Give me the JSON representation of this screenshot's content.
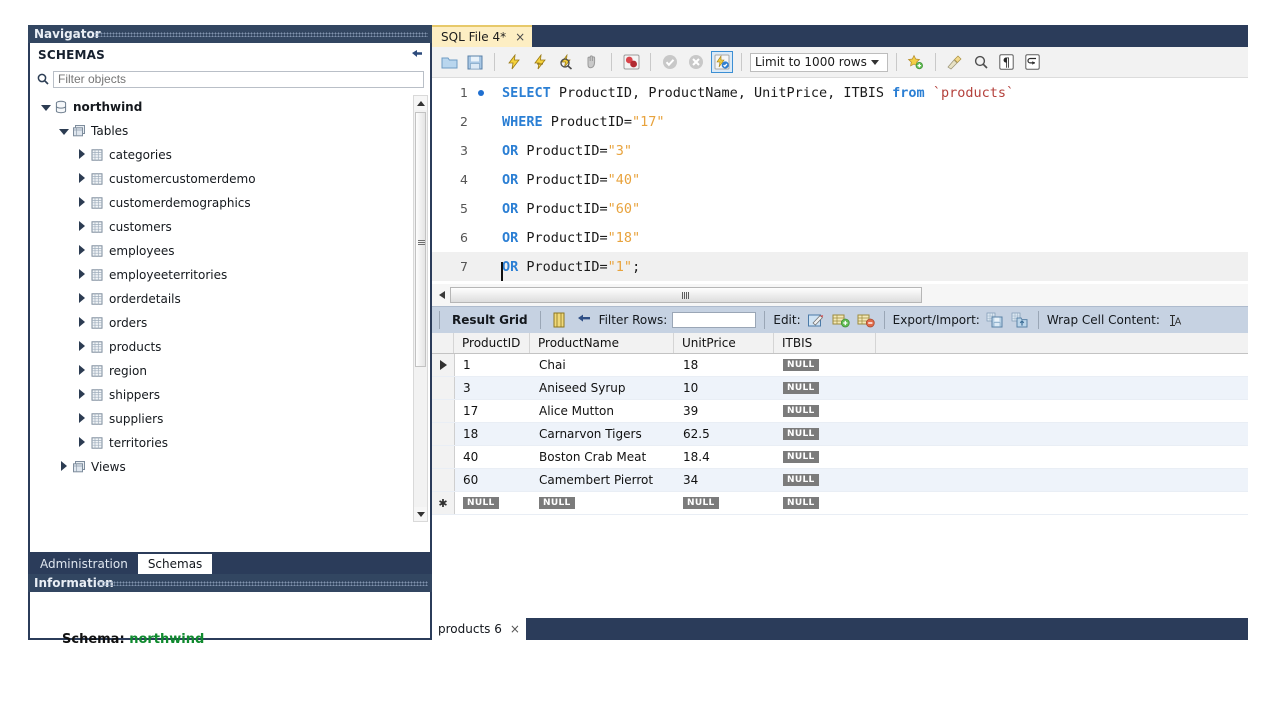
{
  "navigator": {
    "title": "Navigator",
    "schemas_header": "SCHEMAS",
    "refresh_icon": "refresh-icon",
    "filter": {
      "placeholder": "Filter objects",
      "value": "",
      "icon": "search-icon"
    },
    "tree": [
      {
        "label": "northwind",
        "level": 0,
        "expanded": true,
        "icon": "database-icon",
        "bold": true
      },
      {
        "label": "Tables",
        "level": 1,
        "expanded": true,
        "icon": "tables-folder-icon",
        "bold": false
      },
      {
        "label": "categories",
        "level": 2,
        "expanded": false,
        "icon": "table-icon",
        "bold": false
      },
      {
        "label": "customercustomerdemo",
        "level": 2,
        "expanded": false,
        "icon": "table-icon",
        "bold": false
      },
      {
        "label": "customerdemographics",
        "level": 2,
        "expanded": false,
        "icon": "table-icon",
        "bold": false
      },
      {
        "label": "customers",
        "level": 2,
        "expanded": false,
        "icon": "table-icon",
        "bold": false
      },
      {
        "label": "employees",
        "level": 2,
        "expanded": false,
        "icon": "table-icon",
        "bold": false
      },
      {
        "label": "employeeterritories",
        "level": 2,
        "expanded": false,
        "icon": "table-icon",
        "bold": false
      },
      {
        "label": "orderdetails",
        "level": 2,
        "expanded": false,
        "icon": "table-icon",
        "bold": false
      },
      {
        "label": "orders",
        "level": 2,
        "expanded": false,
        "icon": "table-icon",
        "bold": false
      },
      {
        "label": "products",
        "level": 2,
        "expanded": false,
        "icon": "table-icon",
        "bold": false
      },
      {
        "label": "region",
        "level": 2,
        "expanded": false,
        "icon": "table-icon",
        "bold": false
      },
      {
        "label": "shippers",
        "level": 2,
        "expanded": false,
        "icon": "table-icon",
        "bold": false
      },
      {
        "label": "suppliers",
        "level": 2,
        "expanded": false,
        "icon": "table-icon",
        "bold": false
      },
      {
        "label": "territories",
        "level": 2,
        "expanded": false,
        "icon": "table-icon",
        "bold": false
      },
      {
        "label": "Views",
        "level": 1,
        "expanded": false,
        "icon": "views-folder-icon",
        "bold": false
      }
    ],
    "tabs": [
      {
        "label": "Administration",
        "active": false
      },
      {
        "label": "Schemas",
        "active": true
      }
    ]
  },
  "information": {
    "title": "Information",
    "schema_label": "Schema:",
    "schema_value": "northwind",
    "schema_value_color": "#0f8a2e"
  },
  "editor": {
    "tab": {
      "label": "SQL File 4*",
      "close": "×"
    },
    "toolbar": {
      "buttons": [
        {
          "name": "open-sql-script-icon"
        },
        {
          "name": "save-sql-script-icon"
        },
        {
          "name": "execute-statement-icon"
        },
        {
          "name": "execute-current-statement-icon"
        },
        {
          "name": "explain-statement-icon"
        },
        {
          "name": "stop-statement-icon"
        },
        {
          "name": "toggle-stop-on-error-icon"
        },
        {
          "name": "commit-icon"
        },
        {
          "name": "rollback-icon"
        },
        {
          "name": "toggle-autocommit-icon",
          "selected": true
        }
      ],
      "limit_label": "Limit to 1000 rows",
      "right_buttons": [
        {
          "name": "add-snippet-icon"
        },
        {
          "name": "beautify-query-icon"
        },
        {
          "name": "find-icon"
        },
        {
          "name": "toggle-invisible-chars-icon"
        },
        {
          "name": "toggle-word-wrap-icon"
        }
      ]
    },
    "code_lines": [
      {
        "num": "1",
        "breakpoint": true,
        "current": false,
        "tokens": [
          {
            "t": "SELECT",
            "c": "kw"
          },
          {
            "t": " ProductID, ProductName, UnitPrice, ITBIS ",
            "c": ""
          },
          {
            "t": "from",
            "c": "kw"
          },
          {
            "t": " ",
            "c": ""
          },
          {
            "t": "`products`",
            "c": "bq"
          }
        ]
      },
      {
        "num": "2",
        "breakpoint": false,
        "current": false,
        "tokens": [
          {
            "t": "WHERE",
            "c": "kw"
          },
          {
            "t": " ProductID=",
            "c": ""
          },
          {
            "t": "\"17\"",
            "c": "str"
          }
        ]
      },
      {
        "num": "3",
        "breakpoint": false,
        "current": false,
        "tokens": [
          {
            "t": "OR",
            "c": "kw"
          },
          {
            "t": " ProductID=",
            "c": ""
          },
          {
            "t": "\"3\"",
            "c": "str"
          }
        ]
      },
      {
        "num": "4",
        "breakpoint": false,
        "current": false,
        "tokens": [
          {
            "t": "OR",
            "c": "kw"
          },
          {
            "t": " ProductID=",
            "c": ""
          },
          {
            "t": "\"40\"",
            "c": "str"
          }
        ]
      },
      {
        "num": "5",
        "breakpoint": false,
        "current": false,
        "tokens": [
          {
            "t": "OR",
            "c": "kw"
          },
          {
            "t": " ProductID=",
            "c": ""
          },
          {
            "t": "\"60\"",
            "c": "str"
          }
        ]
      },
      {
        "num": "6",
        "breakpoint": false,
        "current": false,
        "tokens": [
          {
            "t": "OR",
            "c": "kw"
          },
          {
            "t": " ProductID=",
            "c": ""
          },
          {
            "t": "\"18\"",
            "c": "str"
          }
        ]
      },
      {
        "num": "7",
        "breakpoint": false,
        "current": true,
        "tokens": [
          {
            "t": "OR",
            "c": "kw"
          },
          {
            "t": " ProductID=",
            "c": ""
          },
          {
            "t": "\"1\"",
            "c": "str"
          },
          {
            "t": ";",
            "c": ""
          }
        ]
      }
    ],
    "full_query": "SELECT ProductID, ProductName, UnitPrice, ITBIS from `products` WHERE ProductID=\"17\" OR ProductID=\"3\" OR ProductID=\"40\" OR ProductID=\"60\" OR ProductID=\"18\" OR ProductID=\"1\";"
  },
  "result_toolbar": {
    "result_grid_label": "Result Grid",
    "grid_view_icon": "grid-view-icon",
    "refresh_icon": "refresh-grid-icon",
    "filter_rows_label": "Filter Rows:",
    "filter_rows_value": "",
    "edit_label": "Edit:",
    "edit_icons": [
      "edit-row-icon",
      "insert-row-icon",
      "delete-row-icon"
    ],
    "export_label": "Export/Import:",
    "export_icons": [
      "export-recordset-icon",
      "import-recordset-icon"
    ],
    "wrap_label": "Wrap Cell Content:",
    "wrap_icon": "wrap-cell-icon"
  },
  "result_grid": {
    "columns": [
      "ProductID",
      "ProductName",
      "UnitPrice",
      "ITBIS"
    ],
    "rows": [
      {
        "selected": true,
        "cells": [
          "1",
          "Chai",
          "18",
          "NULL"
        ]
      },
      {
        "selected": false,
        "cells": [
          "3",
          "Aniseed Syrup",
          "10",
          "NULL"
        ]
      },
      {
        "selected": false,
        "cells": [
          "17",
          "Alice Mutton",
          "39",
          "NULL"
        ]
      },
      {
        "selected": false,
        "cells": [
          "18",
          "Carnarvon Tigers",
          "62.5",
          "NULL"
        ]
      },
      {
        "selected": false,
        "cells": [
          "40",
          "Boston Crab Meat",
          "18.4",
          "NULL"
        ]
      },
      {
        "selected": false,
        "cells": [
          "60",
          "Camembert Pierrot",
          "34",
          "NULL"
        ]
      }
    ],
    "new_row": {
      "cells": [
        "NULL",
        "NULL",
        "NULL",
        "NULL"
      ]
    },
    "null_text": "NULL"
  },
  "bottom_tabs": [
    {
      "label": "products 6",
      "close": "×",
      "active": true
    }
  ]
}
